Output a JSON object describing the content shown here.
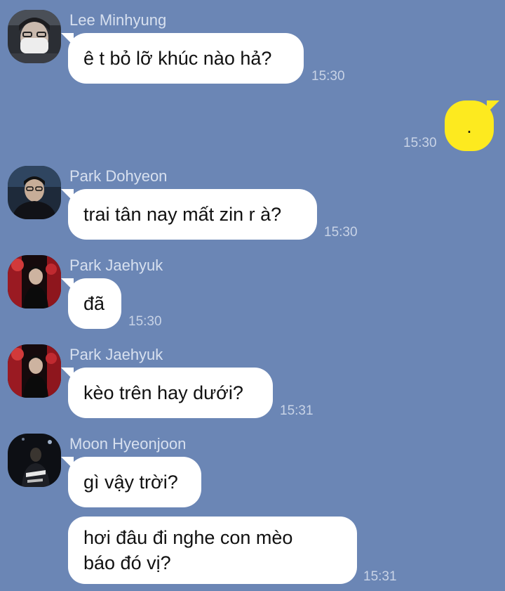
{
  "messages": [
    {
      "sender": "Lee Minhyung",
      "avatar": "avatar-lee-minhyung",
      "text": "ê t bỏ lỡ khúc nào hả?",
      "time": "15:30"
    },
    {
      "sender": "me",
      "text": ".",
      "time": "15:30"
    },
    {
      "sender": "Park Dohyeon",
      "avatar": "avatar-park-dohyeon",
      "text": "trai tân nay mất zin r à?",
      "time": "15:30"
    },
    {
      "sender": "Park Jaehyuk",
      "avatar": "avatar-park-jaehyuk",
      "text": "đã",
      "time": "15:30"
    },
    {
      "sender": "Park Jaehyuk",
      "avatar": "avatar-park-jaehyuk",
      "text": "kèo trên hay dưới?",
      "time": "15:31"
    },
    {
      "sender": "Moon Hyeonjoon",
      "avatar": "avatar-moon-hyeonjoon",
      "text": "gì vậy trời?",
      "time": ""
    },
    {
      "sender": "Moon Hyeonjoon",
      "text": "hơi đâu đi nghe con mèo\nbáo đó vị?",
      "time": "15:31"
    }
  ],
  "colors": {
    "background": "#6b86b5",
    "incoming_bubble": "#ffffff",
    "outgoing_bubble": "#fdea1f"
  }
}
